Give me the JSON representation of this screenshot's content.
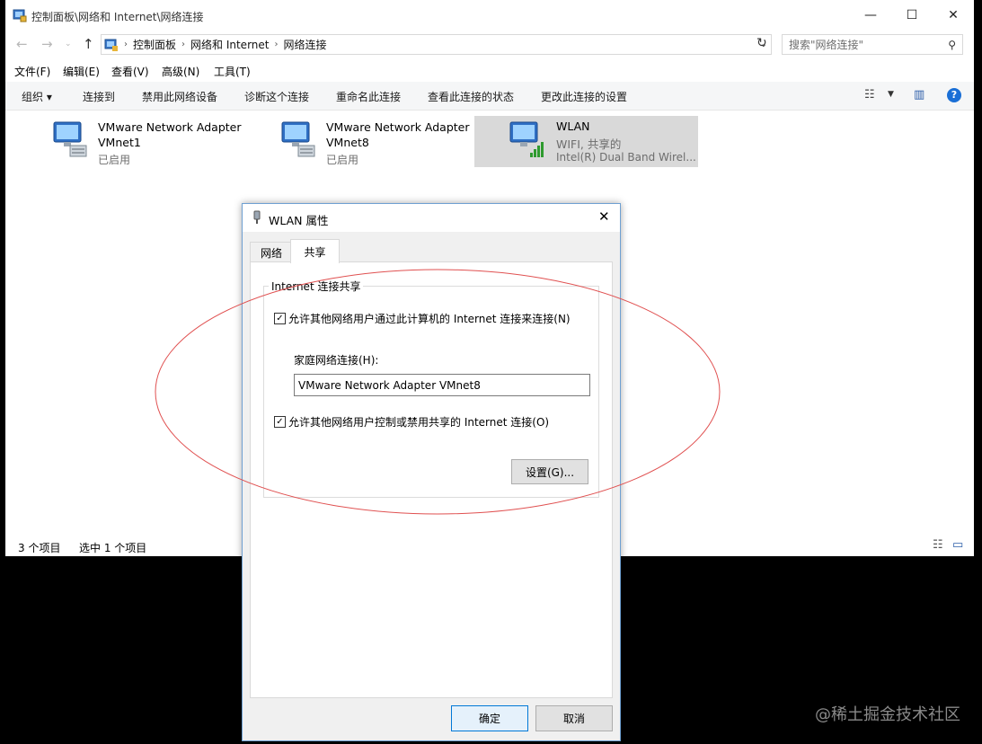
{
  "window": {
    "title": "控制面板\\网络和 Internet\\网络连接",
    "min_icon": "minimize-icon",
    "max_icon": "maximize-icon",
    "close_icon": "close-icon"
  },
  "address": {
    "crumbs": [
      "控制面板",
      "网络和 Internet",
      "网络连接"
    ],
    "search_placeholder": "搜索\"网络连接\""
  },
  "menu": [
    "文件(F)",
    "编辑(E)",
    "查看(V)",
    "高级(N)",
    "工具(T)"
  ],
  "commands": {
    "organize": "组织 ▾",
    "items": [
      "连接到",
      "禁用此网络设备",
      "诊断这个连接",
      "重命名此连接",
      "查看此连接的状态",
      "更改此连接的设置"
    ]
  },
  "adapters": [
    {
      "name": "VMware Network Adapter",
      "sub": "VMnet1",
      "status": "已启用"
    },
    {
      "name": "VMware Network Adapter",
      "sub": "VMnet8",
      "status": "已启用"
    },
    {
      "name": "WLAN",
      "sub": "WIFI, 共享的",
      "status": "Intel(R) Dual Band Wirel..."
    }
  ],
  "statusbar": {
    "count": "3 个项目",
    "selected": "选中 1 个项目"
  },
  "dialog": {
    "title": "WLAN 属性",
    "tabs": [
      "网络",
      "共享"
    ],
    "group_title": "Internet 连接共享",
    "check1": "允许其他网络用户通过此计算机的 Internet 连接来连接(N)",
    "home_label": "家庭网络连接(H):",
    "home_value": "VMware Network Adapter VMnet8",
    "check2": "允许其他网络用户控制或禁用共享的 Internet 连接(O)",
    "settings_button": "设置(G)...",
    "ok_button": "确定",
    "cancel_button": "取消"
  },
  "watermark": "@稀土掘金技术社区",
  "colors": {
    "accent": "#0078d7",
    "annotation": "#e05050",
    "selection": "#d9d9d9"
  }
}
